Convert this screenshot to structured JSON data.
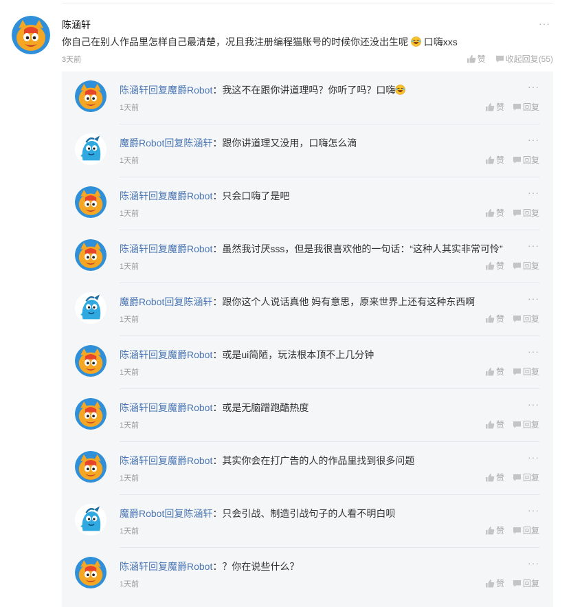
{
  "main": {
    "name": "陈涵轩",
    "text": "你自己在别人作品里怎样自己最清楚，况且我注册编程猫账号的时候你还没出生呢",
    "text_suffix": "口嗨xxs",
    "time": "3天前",
    "like_label": "赞",
    "collapse_label": "收起回复(55)",
    "more": "···",
    "avatar_icon": "orange-cat-avatar-icon",
    "emoji_icon": "laughing-emoji-icon"
  },
  "replies": [
    {
      "from": "陈涵轩",
      "verb": "回复",
      "to": "魔爵Robot",
      "sep": "：",
      "text": "我这不在跟你讲道理吗？你听了吗？口嗨",
      "emoji": true,
      "time": "1天前",
      "like": "赞",
      "reply": "回复",
      "avatar": "orange"
    },
    {
      "from": "魔爵Robot",
      "verb": "回复",
      "to": "陈涵轩",
      "sep": "：",
      "text": "跟你讲道理又没用，口嗨怎么滴",
      "emoji": false,
      "time": "1天前",
      "like": "赞",
      "reply": "回复",
      "avatar": "blue"
    },
    {
      "from": "陈涵轩",
      "verb": "回复",
      "to": "魔爵Robot",
      "sep": "：",
      "text": "只会口嗨了是吧",
      "emoji": false,
      "time": "1天前",
      "like": "赞",
      "reply": "回复",
      "avatar": "orange"
    },
    {
      "from": "陈涵轩",
      "verb": "回复",
      "to": "魔爵Robot",
      "sep": "：",
      "text": "虽然我讨厌sss，但是我很喜欢他的一句话：“这种人其实非常可怜”",
      "emoji": false,
      "time": "1天前",
      "like": "赞",
      "reply": "回复",
      "avatar": "orange"
    },
    {
      "from": "魔爵Robot",
      "verb": "回复",
      "to": "陈涵轩",
      "sep": "：",
      "text": "跟你这个人说话真他 妈有意思，原来世界上还有这种东西啊",
      "emoji": false,
      "time": "1天前",
      "like": "赞",
      "reply": "回复",
      "avatar": "blue"
    },
    {
      "from": "陈涵轩",
      "verb": "回复",
      "to": "魔爵Robot",
      "sep": "：",
      "text": "或是ui简陋，玩法根本顶不上几分钟",
      "emoji": false,
      "time": "1天前",
      "like": "赞",
      "reply": "回复",
      "avatar": "orange"
    },
    {
      "from": "陈涵轩",
      "verb": "回复",
      "to": "魔爵Robot",
      "sep": "：",
      "text": "或是无脑蹭跑酷热度",
      "emoji": false,
      "time": "1天前",
      "like": "赞",
      "reply": "回复",
      "avatar": "orange"
    },
    {
      "from": "陈涵轩",
      "verb": "回复",
      "to": "魔爵Robot",
      "sep": "：",
      "text": "其实你会在打广告的人的作品里找到很多问题",
      "emoji": false,
      "time": "1天前",
      "like": "赞",
      "reply": "回复",
      "avatar": "orange"
    },
    {
      "from": "魔爵Robot",
      "verb": "回复",
      "to": "陈涵轩",
      "sep": "：",
      "text": "只会引战、制造引战句子的人看不明白呗",
      "emoji": false,
      "time": "1天前",
      "like": "赞",
      "reply": "回复",
      "avatar": "blue"
    },
    {
      "from": "陈涵轩",
      "verb": "回复",
      "to": "魔爵Robot",
      "sep": "：",
      "text": "？你在说些什么？",
      "emoji": false,
      "time": "1天前",
      "like": "赞",
      "reply": "回复",
      "avatar": "orange"
    }
  ],
  "colors": {
    "link": "#4a76b4",
    "muted": "#999999",
    "panel": "#f5f6f8"
  }
}
